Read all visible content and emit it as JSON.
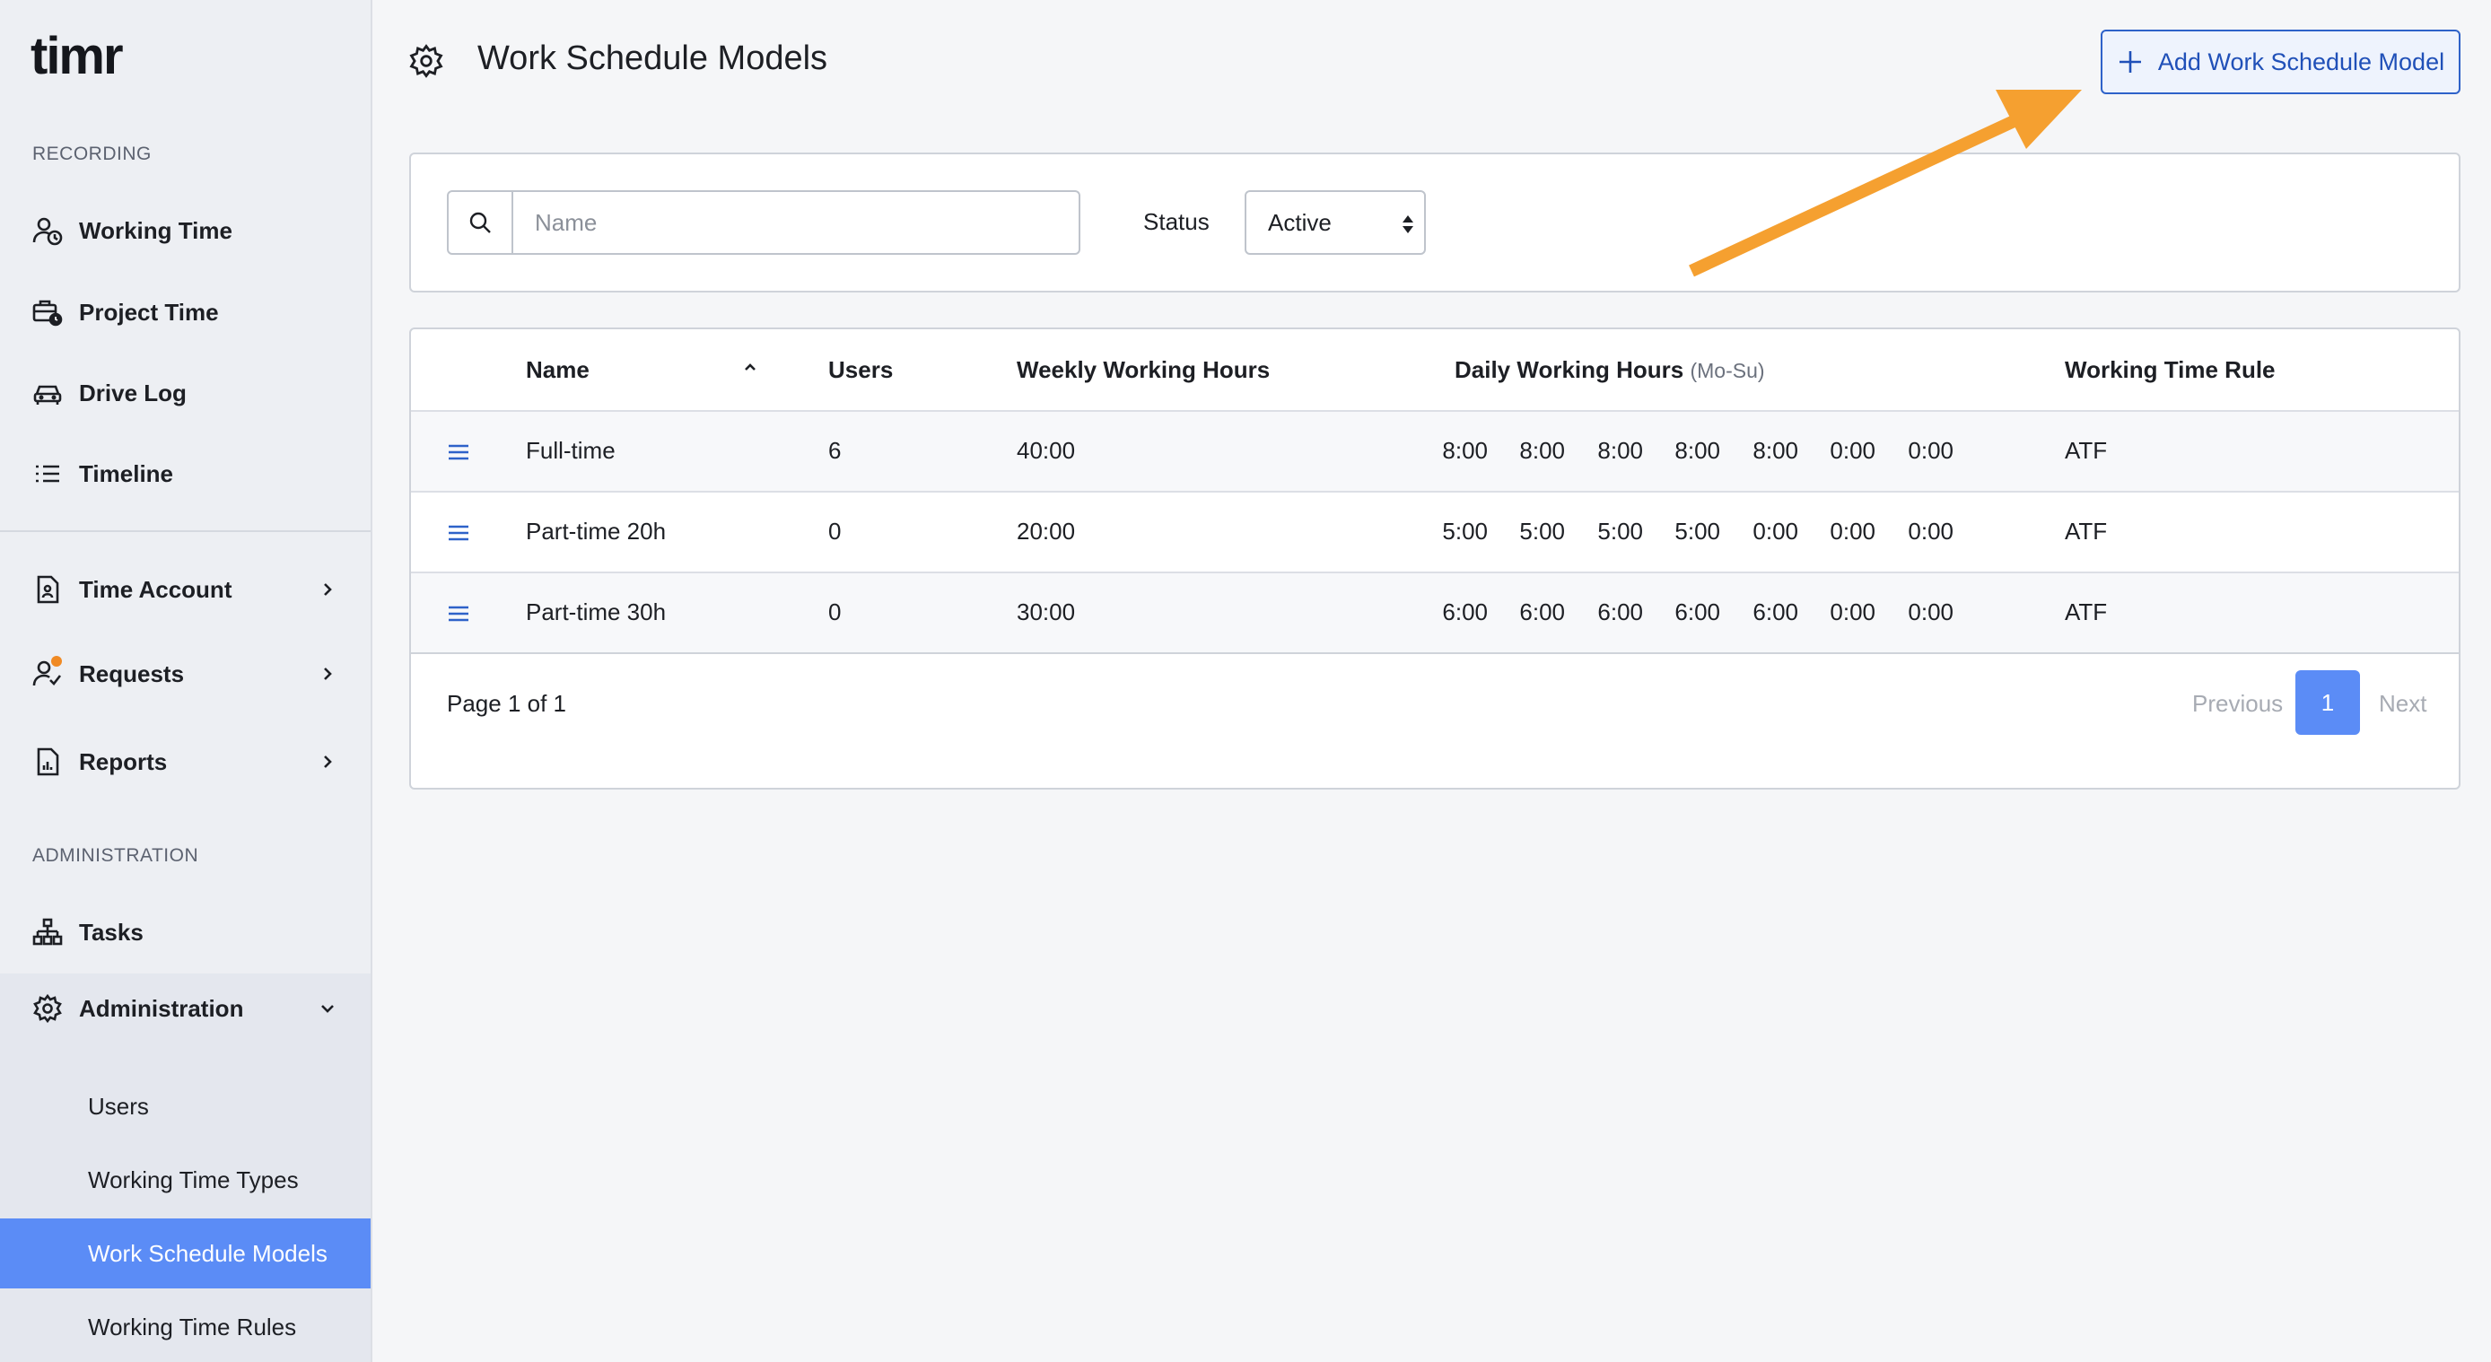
{
  "sidebar": {
    "logo_text": "timr",
    "recording_label": "RECORDING",
    "recording_items": [
      {
        "label": "Working Time",
        "icon": "user-clock-icon"
      },
      {
        "label": "Project Time",
        "icon": "briefcase-clock-icon"
      },
      {
        "label": "Drive Log",
        "icon": "car-icon"
      },
      {
        "label": "Timeline",
        "icon": "list-icon"
      }
    ],
    "account_items": [
      {
        "label": "Time Account",
        "icon": "document-user-icon"
      },
      {
        "label": "Requests",
        "icon": "user-check-icon"
      },
      {
        "label": "Reports",
        "icon": "report-icon"
      }
    ],
    "administration_label": "ADMINISTRATION",
    "admin_items": [
      {
        "label": "Tasks",
        "icon": "hierarchy-icon"
      },
      {
        "label": "Administration",
        "icon": "gear-icon"
      }
    ],
    "admin_sub_items": [
      {
        "label": "Users"
      },
      {
        "label": "Working Time Types"
      },
      {
        "label": "Work Schedule Models",
        "active": true
      },
      {
        "label": "Working Time Rules"
      }
    ]
  },
  "header": {
    "title": "Work Schedule Models",
    "add_button_label": "Add Work Schedule Model"
  },
  "filters": {
    "search_placeholder": "Name",
    "search_value": "",
    "status_label": "Status",
    "status_value": "Active"
  },
  "table": {
    "columns": {
      "name": "Name",
      "users": "Users",
      "weekly": "Weekly Working Hours",
      "daily": "Daily Working Hours",
      "daily_suffix": "(Mo-Su)",
      "rule": "Working Time Rule"
    },
    "rows": [
      {
        "name": "Full-time",
        "users": "6",
        "weekly": "40:00",
        "daily": [
          "8:00",
          "8:00",
          "8:00",
          "8:00",
          "8:00",
          "0:00",
          "0:00"
        ],
        "rule": "ATF"
      },
      {
        "name": "Part-time 20h",
        "users": "0",
        "weekly": "20:00",
        "daily": [
          "5:00",
          "5:00",
          "5:00",
          "5:00",
          "0:00",
          "0:00",
          "0:00"
        ],
        "rule": "ATF"
      },
      {
        "name": "Part-time 30h",
        "users": "0",
        "weekly": "30:00",
        "daily": [
          "6:00",
          "6:00",
          "6:00",
          "6:00",
          "6:00",
          "0:00",
          "0:00"
        ],
        "rule": "ATF"
      }
    ]
  },
  "pagination": {
    "page_info": "Page 1 of 1",
    "previous": "Previous",
    "current": "1",
    "next": "Next"
  },
  "colors": {
    "accent": "#5b8cf6",
    "button_border": "#2e62c9",
    "annotation_arrow": "#f5a030",
    "notification_dot": "#f08a24"
  }
}
